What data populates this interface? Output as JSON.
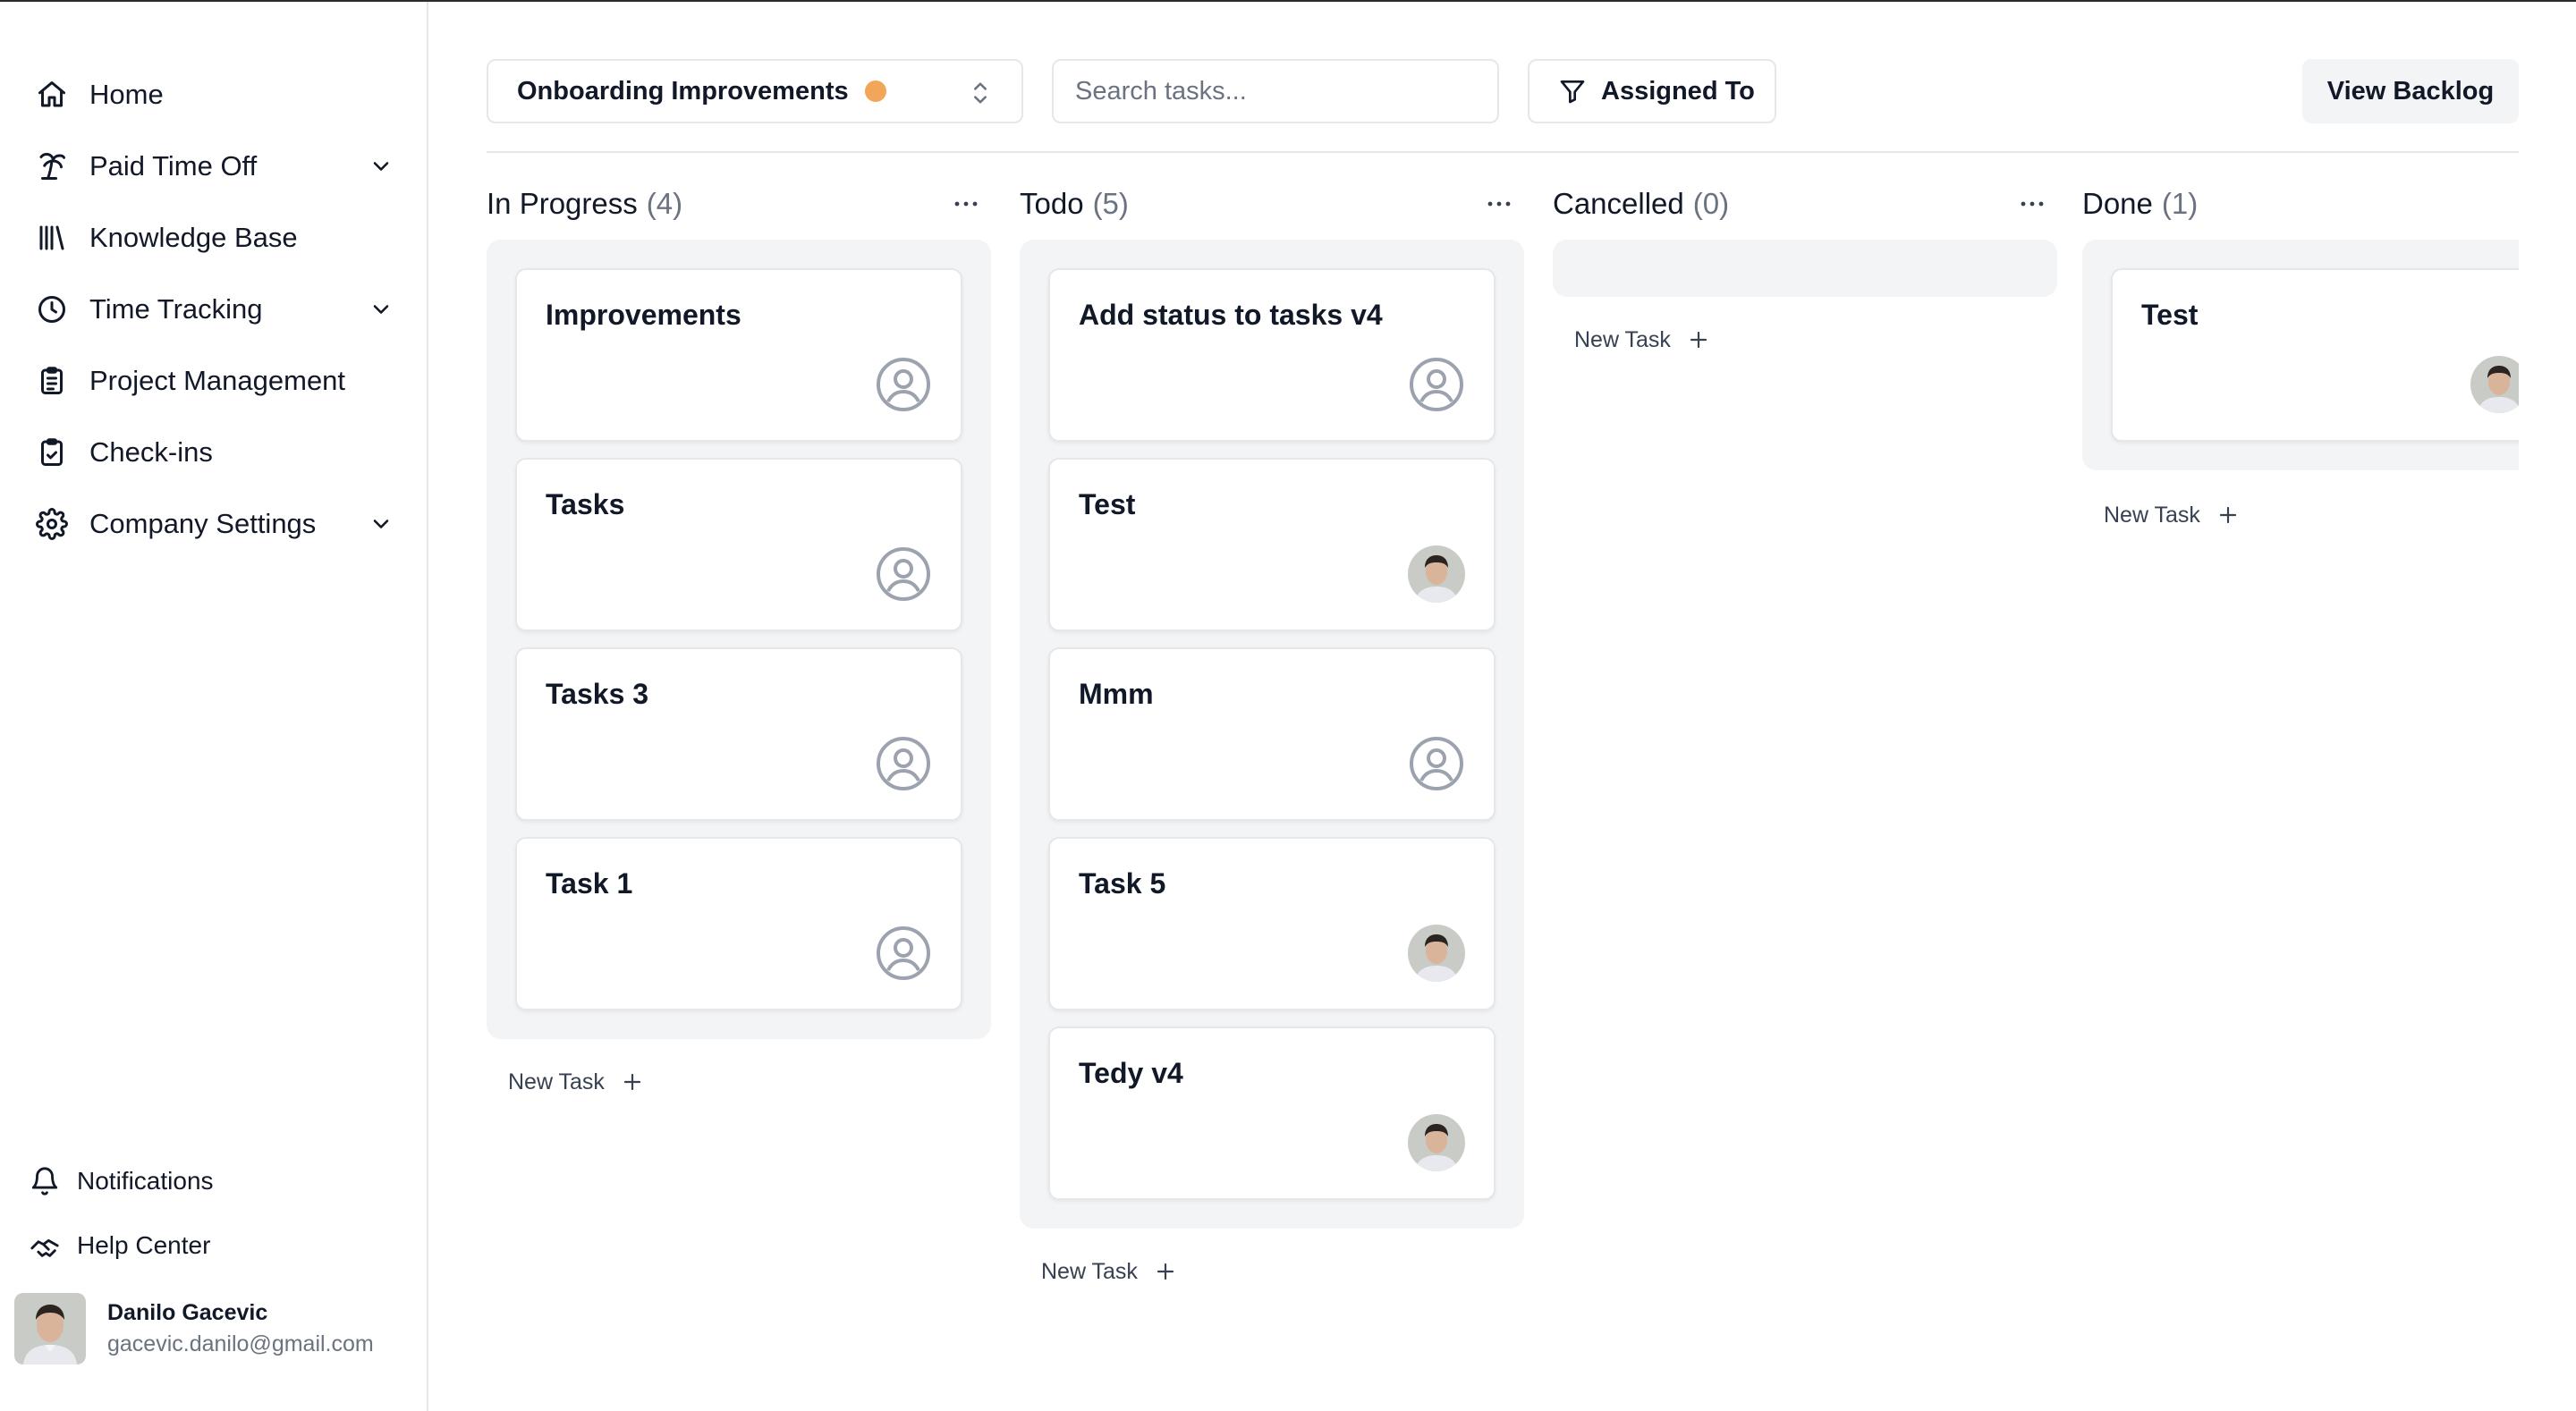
{
  "sidebar": {
    "nav": [
      {
        "label": "Home",
        "icon": "home-icon",
        "expandable": false
      },
      {
        "label": "Paid Time Off",
        "icon": "palm-tree-icon",
        "expandable": true
      },
      {
        "label": "Knowledge Base",
        "icon": "library-icon",
        "expandable": false
      },
      {
        "label": "Time Tracking",
        "icon": "clock-icon",
        "expandable": true
      },
      {
        "label": "Project Management",
        "icon": "clipboard-list-icon",
        "expandable": false
      },
      {
        "label": "Check-ins",
        "icon": "clipboard-check-icon",
        "expandable": false
      },
      {
        "label": "Company Settings",
        "icon": "gear-icon",
        "expandable": true
      }
    ],
    "notifications_label": "Notifications",
    "help_label": "Help Center",
    "user": {
      "name": "Danilo Gacevic",
      "email": "gacevic.danilo@gmail.com"
    }
  },
  "toolbar": {
    "project_name": "Onboarding Improvements",
    "project_status_color": "#f2a65a",
    "search_placeholder": "Search tasks...",
    "search_value": "",
    "assigned_label": "Assigned To",
    "backlog_label": "View Backlog"
  },
  "board": {
    "new_task_label": "New Task",
    "columns": [
      {
        "title": "In Progress",
        "count": "(4)",
        "tasks": [
          {
            "title": "Improvements",
            "assignee": "none"
          },
          {
            "title": "Tasks",
            "assignee": "none"
          },
          {
            "title": "Tasks 3",
            "assignee": "none"
          },
          {
            "title": "Task 1",
            "assignee": "none"
          }
        ]
      },
      {
        "title": "Todo",
        "count": "(5)",
        "tasks": [
          {
            "title": "Add status to tasks v4",
            "assignee": "none"
          },
          {
            "title": "Test",
            "assignee": "photo"
          },
          {
            "title": "Mmm",
            "assignee": "none"
          },
          {
            "title": "Task 5",
            "assignee": "photo"
          },
          {
            "title": "Tedy v4",
            "assignee": "photo"
          }
        ]
      },
      {
        "title": "Cancelled",
        "count": "(0)",
        "tasks": []
      },
      {
        "title": "Done",
        "count": "(1)",
        "tasks": [
          {
            "title": "Test",
            "assignee": "photo"
          }
        ]
      }
    ]
  }
}
